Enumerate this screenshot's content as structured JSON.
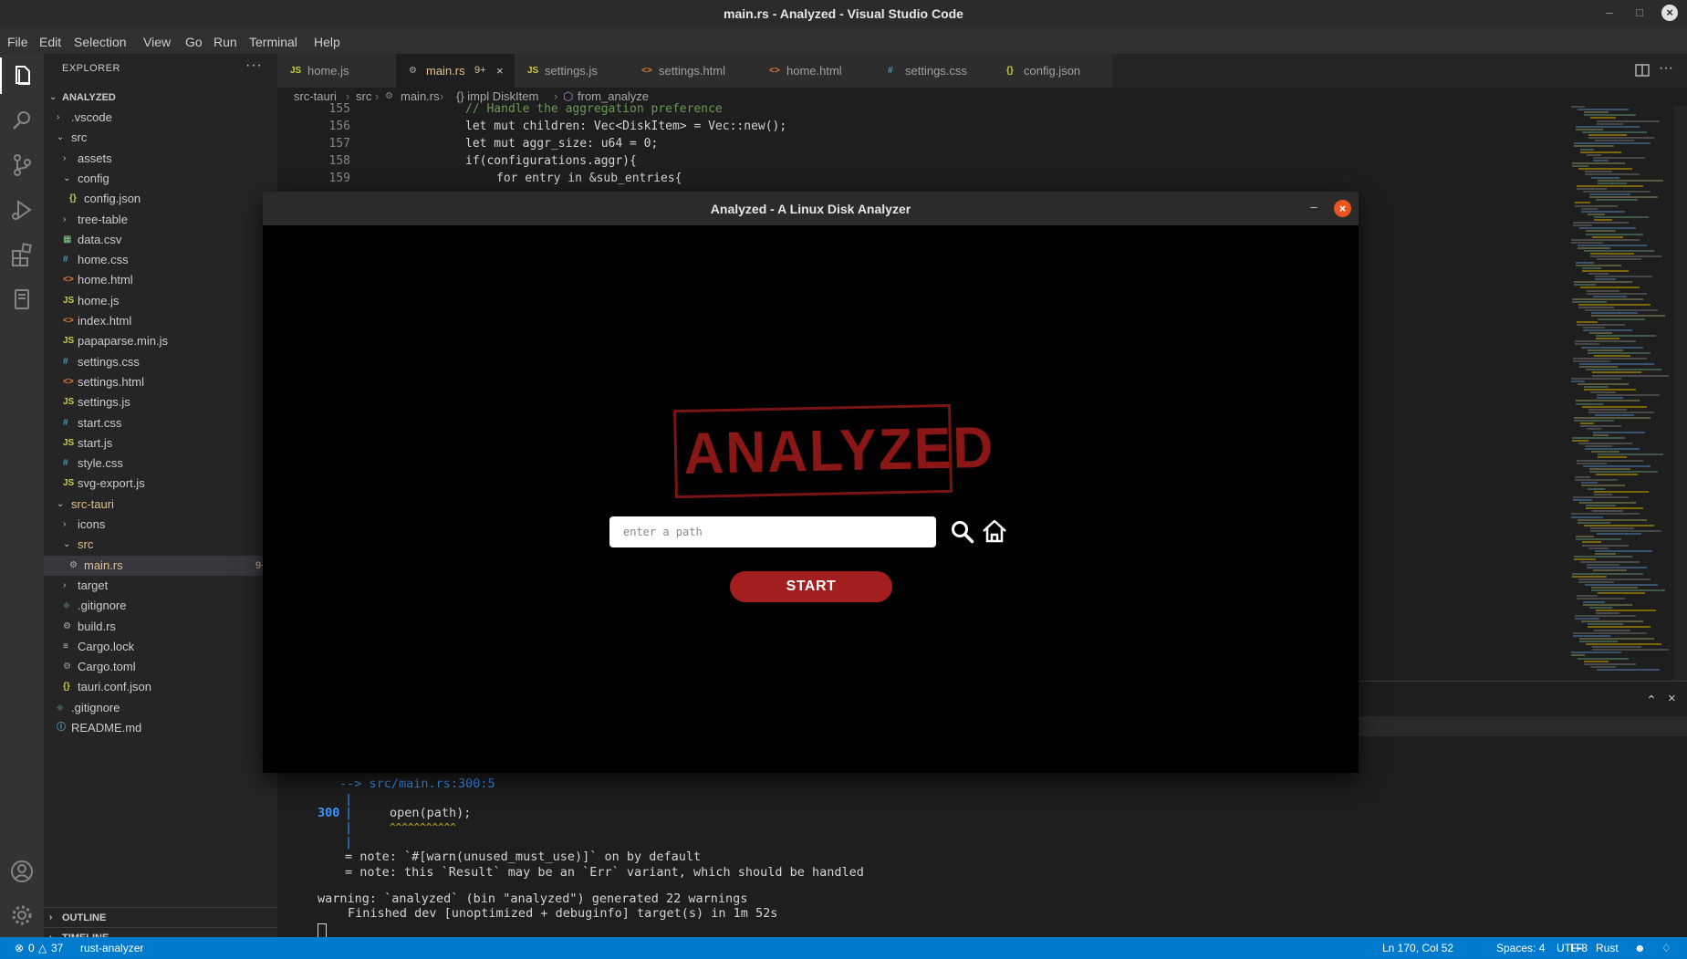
{
  "window": {
    "title": "main.rs - Analyzed - Visual Studio Code"
  },
  "menu": [
    "File",
    "Edit",
    "Selection",
    "View",
    "Go",
    "Run",
    "Terminal",
    "Help"
  ],
  "explorer": {
    "header": "EXPLORER",
    "root": "ANALYZED",
    "items": [
      {
        "label": ".vscode",
        "type": "folder",
        "depth": 1,
        "expanded": false
      },
      {
        "label": "src",
        "type": "folder",
        "depth": 1,
        "expanded": true
      },
      {
        "label": "assets",
        "type": "folder",
        "depth": 2,
        "expanded": false
      },
      {
        "label": "config",
        "type": "folder",
        "depth": 2,
        "expanded": true
      },
      {
        "label": "config.json",
        "type": "json",
        "depth": 3
      },
      {
        "label": "tree-table",
        "type": "folder",
        "depth": 2,
        "expanded": false
      },
      {
        "label": "data.csv",
        "type": "csv",
        "depth": 2
      },
      {
        "label": "home.css",
        "type": "css",
        "depth": 2
      },
      {
        "label": "home.html",
        "type": "html",
        "depth": 2
      },
      {
        "label": "home.js",
        "type": "js",
        "depth": 2
      },
      {
        "label": "index.html",
        "type": "html",
        "depth": 2
      },
      {
        "label": "papaparse.min.js",
        "type": "js",
        "depth": 2
      },
      {
        "label": "settings.css",
        "type": "css",
        "depth": 2
      },
      {
        "label": "settings.html",
        "type": "html",
        "depth": 2
      },
      {
        "label": "settings.js",
        "type": "js",
        "depth": 2
      },
      {
        "label": "start.css",
        "type": "css",
        "depth": 2
      },
      {
        "label": "start.js",
        "type": "js",
        "depth": 2
      },
      {
        "label": "style.css",
        "type": "css",
        "depth": 2
      },
      {
        "label": "svg-export.js",
        "type": "js",
        "depth": 2
      },
      {
        "label": "src-tauri",
        "type": "folder",
        "depth": 1,
        "expanded": true,
        "modified": true
      },
      {
        "label": "icons",
        "type": "folder",
        "depth": 2,
        "expanded": false
      },
      {
        "label": "src",
        "type": "folder",
        "depth": 2,
        "expanded": true,
        "modified": true
      },
      {
        "label": "main.rs",
        "type": "rust",
        "depth": 3,
        "selected": true,
        "badge": "9+"
      },
      {
        "label": "target",
        "type": "folder",
        "depth": 2,
        "expanded": false
      },
      {
        "label": ".gitignore",
        "type": "git",
        "depth": 2
      },
      {
        "label": "build.rs",
        "type": "rust",
        "depth": 2
      },
      {
        "label": "Cargo.lock",
        "type": "lock",
        "depth": 2
      },
      {
        "label": "Cargo.toml",
        "type": "toml",
        "depth": 2
      },
      {
        "label": "tauri.conf.json",
        "type": "json",
        "depth": 2
      },
      {
        "label": ".gitignore",
        "type": "git",
        "depth": 1
      },
      {
        "label": "README.md",
        "type": "info",
        "depth": 1
      }
    ],
    "outline": "OUTLINE",
    "timeline": "TIMELINE"
  },
  "tabs": [
    {
      "icon": "JS",
      "label": "home.js"
    },
    {
      "icon": "rs",
      "label": "main.rs",
      "badge": "9+",
      "active": true
    },
    {
      "icon": "JS",
      "label": "settings.js"
    },
    {
      "icon": "<>",
      "label": "settings.html"
    },
    {
      "icon": "<>",
      "label": "home.html"
    },
    {
      "icon": "#",
      "label": "settings.css"
    },
    {
      "icon": "{}",
      "label": "config.json"
    }
  ],
  "breadcrumb": [
    "src-tauri",
    "src",
    "main.rs",
    "{} impl DiskItem",
    "from_analyze"
  ],
  "code": [
    {
      "line": "155",
      "text": "// Handle the aggregation preference"
    },
    {
      "line": "156",
      "text": "let mut children: Vec<DiskItem> = Vec::new();"
    },
    {
      "line": "157",
      "text": "let mut aggr_size: u64 = 0;"
    },
    {
      "line": "158",
      "text": "if(configurations.aggr){"
    },
    {
      "line": "159",
      "text": "for entry in &sub_entries{"
    }
  ],
  "terminal": [
    "--> src/main.rs:300:5",
    "|",
    "300",
    "open(path);",
    "^^^^^^^^^^^",
    "= note: `#[warn(unused_must_use)]` on by default",
    "= note: this `Result` may be an `Err` variant, which should be handled",
    "warning: `analyzed` (bin \"analyzed\") generated 22 warnings",
    "Finished dev [unoptimized + debuginfo] target(s) in 1m 52s"
  ],
  "terminal_parts": {
    "note_label": "note",
    "warning_label": "warning",
    "finished_label": "Finished"
  },
  "status": {
    "errors": "0",
    "warnings": "37",
    "extension": "rust-analyzer",
    "position": "Ln 170, Col 52",
    "spaces": "Spaces: 4",
    "encoding": "UTF-8",
    "eol": "LF",
    "language": "Rust"
  },
  "app": {
    "title": "Analyzed - A Linux Disk Analyzer",
    "logo_text": "ANALYZED",
    "path_placeholder": "enter a path",
    "start_label": "START"
  },
  "colors": {
    "accent": "#007acc",
    "start_button": "#a31f1f",
    "stamp": "#8a1616",
    "close_button": "#e95420"
  }
}
